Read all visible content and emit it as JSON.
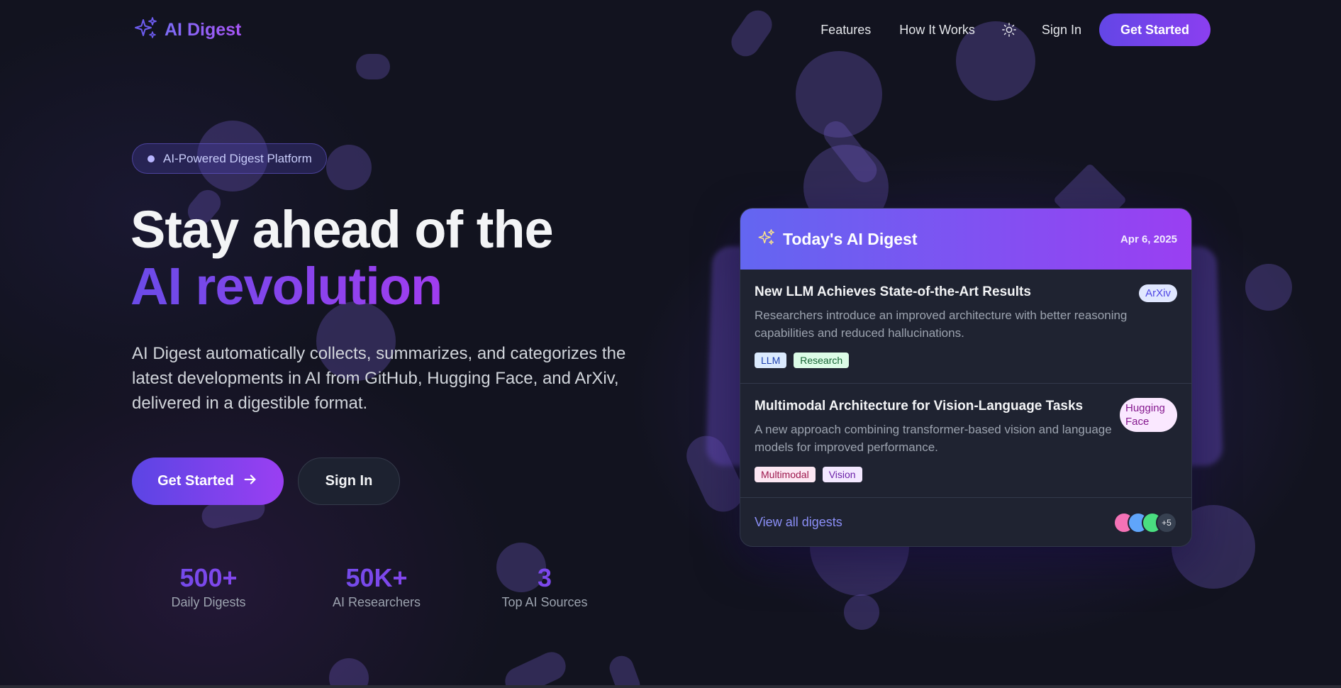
{
  "nav": {
    "logo_text": "AI Digest",
    "links": [
      "Features",
      "How It Works"
    ],
    "theme_icon": "sun-icon",
    "sign_in": "Sign In",
    "cta": "Get Started"
  },
  "hero": {
    "badge": "AI-Powered Digest Platform",
    "title_line1": "Stay ahead of the",
    "title_line2": "AI revolution",
    "description": "AI Digest automatically collects, summarizes, and categorizes the latest developments in AI from GitHub, Hugging Face, and ArXiv, delivered in a digestible format.",
    "primary_button": "Get Started",
    "secondary_button": "Sign In"
  },
  "stats": [
    {
      "value": "500+",
      "label": "Daily Digests"
    },
    {
      "value": "50K+",
      "label": "AI Researchers"
    },
    {
      "value": "3",
      "label": "Top AI Sources"
    }
  ],
  "card": {
    "title": "Today's AI Digest",
    "date": "Apr 6, 2025",
    "items": [
      {
        "title": "New LLM Achieves State-of-the-Art Results",
        "source": "ArXiv",
        "description": "Researchers introduce an improved architecture with better reasoning capabilities and reduced hallucinations.",
        "tags": [
          "LLM",
          "Research"
        ]
      },
      {
        "title": "Multimodal Architecture for Vision-Language Tasks",
        "source": "Hugging Face",
        "description": "A new approach combining transformer-based vision and language models for improved performance.",
        "tags": [
          "Multimodal",
          "Vision"
        ]
      }
    ],
    "view_all": "View all digests",
    "avatar_more": "+5",
    "avatar_colors": [
      "#f472b6",
      "#60a5fa",
      "#4ade80"
    ]
  },
  "colors": {
    "accent_start": "#6366f1",
    "accent_end": "#9a3ff2",
    "background": "#12131f"
  }
}
